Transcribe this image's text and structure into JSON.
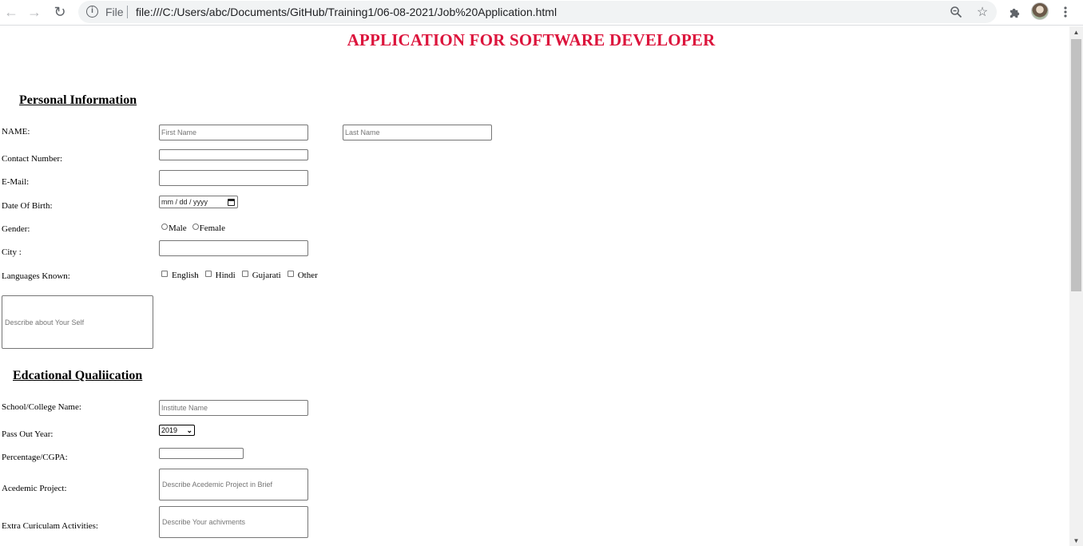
{
  "browser": {
    "file_label": "File",
    "url": "file:///C:/Users/abc/Documents/GitHub/Training1/06-08-2021/Job%20Application.html"
  },
  "page": {
    "title": "APPLICATION FOR SOFTWARE DEVELOPER"
  },
  "personal": {
    "heading": "Personal Information",
    "name_label": "NAME:",
    "first_name_placeholder": "First Name",
    "last_name_placeholder": "Last Name",
    "contact_label": "Contact Number:",
    "email_label": "E-Mail:",
    "dob_label": "Date Of Birth:",
    "dob_placeholder": "mm / dd / yyyy",
    "gender_label": "Gender:",
    "gender_options": [
      "Male",
      "Female"
    ],
    "city_label": "City :",
    "languages_label": "Languages Known:",
    "languages": [
      "English",
      "Hindi",
      "Gujarati",
      "Other"
    ],
    "about_placeholder": "Describe about Your Self"
  },
  "education": {
    "heading": "Edcational Qualiication",
    "school_label": "School/College Name:",
    "school_placeholder": "Institute Name",
    "passout_label": "Pass Out Year:",
    "passout_value": "2019",
    "percentage_label": "Percentage/CGPA:",
    "project_label": "Acedemic Project:",
    "project_placeholder": "Describe Acedemic Project in Brief",
    "extra_label": "Extra Curiculam Activities:",
    "extra_placeholder": "Describe Your achivments"
  },
  "icons": {
    "back": "arrow-left",
    "forward": "arrow-right",
    "reload": "reload",
    "info": "info",
    "zoom": "magnifier",
    "bookmark": "star",
    "extensions": "puzzle",
    "menu": "kebab"
  },
  "colors": {
    "title": "#dc143c",
    "chrome_bg": "#f1f3f4"
  }
}
